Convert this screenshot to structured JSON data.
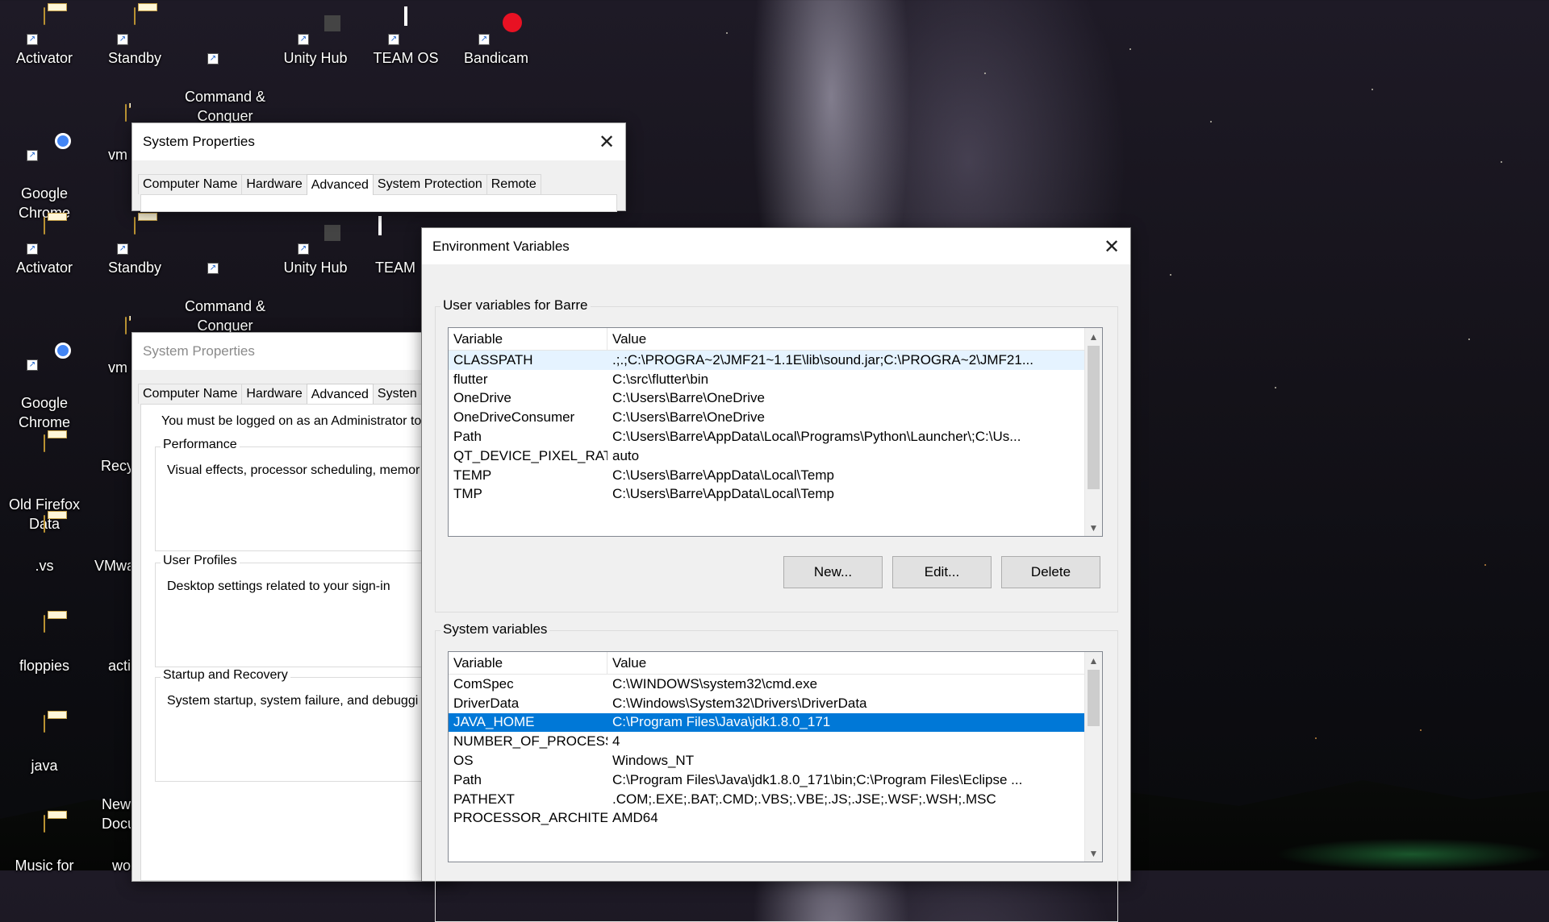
{
  "desktop": {
    "icons_row1": [
      "Activator",
      "Standby",
      "Command &\nConquer Ge...",
      "Unity Hub",
      "TEAM OS",
      "Bandicam"
    ],
    "icons_row2": [
      "Activator",
      "Standby",
      "Command &\nConquer Ge...",
      "Unity Hub",
      "TEAM"
    ],
    "left_column": [
      "Google\nChrome",
      "Google\nChrome",
      "Old Firefox\nData",
      ".vs",
      "floppies",
      "java",
      "Music for"
    ],
    "partial_column": [
      "vm",
      "vm",
      "Recy",
      "VMwa",
      "acti",
      "New\nDocu",
      "wo"
    ]
  },
  "sysprops_top": {
    "title": "System Properties",
    "tabs": [
      "Computer Name",
      "Hardware",
      "Advanced",
      "System Protection",
      "Remote"
    ]
  },
  "sysprops_back": {
    "title": "System Properties",
    "tabs": [
      "Computer Name",
      "Hardware",
      "Advanced",
      "Systen"
    ],
    "admin_note": "You must be logged on as an Administrator to",
    "performance_label": "Performance",
    "performance_text": "Visual effects, processor scheduling, memor",
    "profiles_label": "User Profiles",
    "profiles_text": "Desktop settings related to your sign-in",
    "startup_label": "Startup and Recovery",
    "startup_text": "System startup, system failure, and debuggi"
  },
  "env": {
    "title": "Environment Variables",
    "user_group_label": "User variables for Barre",
    "system_group_label": "System variables",
    "col_variable": "Variable",
    "col_value": "Value",
    "user_vars": [
      {
        "name": "CLASSPATH",
        "value": ".;.;C:\\PROGRA~2\\JMF21~1.1E\\lib\\sound.jar;C:\\PROGRA~2\\JMF21..."
      },
      {
        "name": "flutter",
        "value": "C:\\src\\flutter\\bin"
      },
      {
        "name": "OneDrive",
        "value": "C:\\Users\\Barre\\OneDrive"
      },
      {
        "name": "OneDriveConsumer",
        "value": "C:\\Users\\Barre\\OneDrive"
      },
      {
        "name": "Path",
        "value": "C:\\Users\\Barre\\AppData\\Local\\Programs\\Python\\Launcher\\;C:\\Us..."
      },
      {
        "name": "QT_DEVICE_PIXEL_RATIO",
        "value": "auto"
      },
      {
        "name": "TEMP",
        "value": "C:\\Users\\Barre\\AppData\\Local\\Temp"
      },
      {
        "name": "TMP",
        "value": "C:\\Users\\Barre\\AppData\\Local\\Temp"
      }
    ],
    "system_vars": [
      {
        "name": "ComSpec",
        "value": "C:\\WINDOWS\\system32\\cmd.exe"
      },
      {
        "name": "DriverData",
        "value": "C:\\Windows\\System32\\Drivers\\DriverData"
      },
      {
        "name": "JAVA_HOME",
        "value": "C:\\Program Files\\Java\\jdk1.8.0_171"
      },
      {
        "name": "NUMBER_OF_PROCESSORS",
        "value": "4"
      },
      {
        "name": "OS",
        "value": "Windows_NT"
      },
      {
        "name": "Path",
        "value": "C:\\Program Files\\Java\\jdk1.8.0_171\\bin;C:\\Program Files\\Eclipse ..."
      },
      {
        "name": "PATHEXT",
        "value": ".COM;.EXE;.BAT;.CMD;.VBS;.VBE;.JS;.JSE;.WSF;.WSH;.MSC"
      },
      {
        "name": "PROCESSOR_ARCHITECTURE",
        "value": "AMD64"
      }
    ],
    "selected_system_var": "JAVA_HOME",
    "btn_new": "New...",
    "btn_edit": "Edit...",
    "btn_delete": "Delete"
  },
  "colors": {
    "selection": "#0078d7",
    "dialog_bg": "#f0f0f0",
    "button_bg": "#e1e1e1"
  }
}
